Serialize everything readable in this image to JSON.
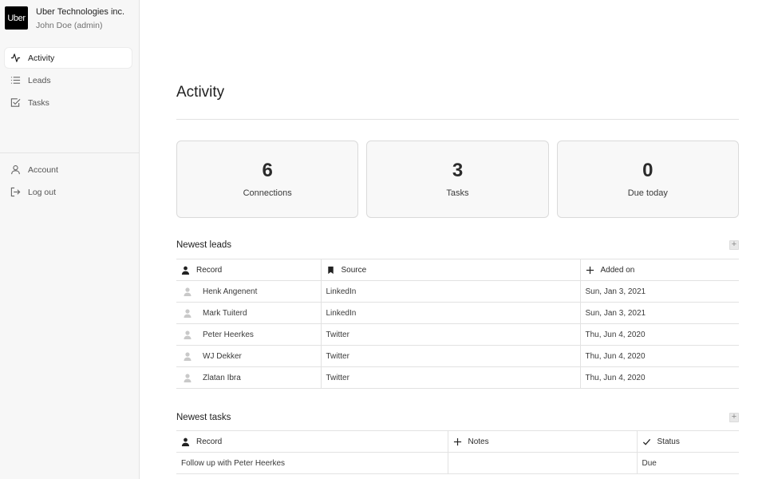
{
  "brand": {
    "logo_text": "Uber",
    "company": "Uber Technologies inc.",
    "user": "John Doe (admin)"
  },
  "nav": {
    "main": [
      {
        "label": "Activity",
        "icon": "activity-icon",
        "active": true
      },
      {
        "label": "Leads",
        "icon": "list-icon",
        "active": false
      },
      {
        "label": "Tasks",
        "icon": "checkbox-icon",
        "active": false
      }
    ],
    "secondary": [
      {
        "label": "Account",
        "icon": "user-icon"
      },
      {
        "label": "Log out",
        "icon": "logout-icon"
      }
    ]
  },
  "page": {
    "title": "Activity"
  },
  "stats": [
    {
      "value": "6",
      "label": "Connections"
    },
    {
      "value": "3",
      "label": "Tasks"
    },
    {
      "value": "0",
      "label": "Due today"
    }
  ],
  "leads": {
    "title": "Newest leads",
    "add_label": "+",
    "columns": [
      "Record",
      "Source",
      "Added on"
    ],
    "rows": [
      {
        "name": "Henk Angenent",
        "source": "LinkedIn",
        "added": "Sun, Jan 3, 2021"
      },
      {
        "name": "Mark Tuiterd",
        "source": "LinkedIn",
        "added": "Sun, Jan 3, 2021"
      },
      {
        "name": "Peter Heerkes",
        "source": "Twitter",
        "added": "Thu, Jun 4, 2020"
      },
      {
        "name": "WJ Dekker",
        "source": "Twitter",
        "added": "Thu, Jun 4, 2020"
      },
      {
        "name": "Zlatan Ibra",
        "source": "Twitter",
        "added": "Thu, Jun 4, 2020"
      }
    ]
  },
  "tasks": {
    "title": "Newest tasks",
    "add_label": "+",
    "columns": [
      "Record",
      "Notes",
      "Status"
    ],
    "rows": [
      {
        "record": "Follow up with Peter Heerkes",
        "notes": "",
        "status": "Due"
      }
    ]
  }
}
